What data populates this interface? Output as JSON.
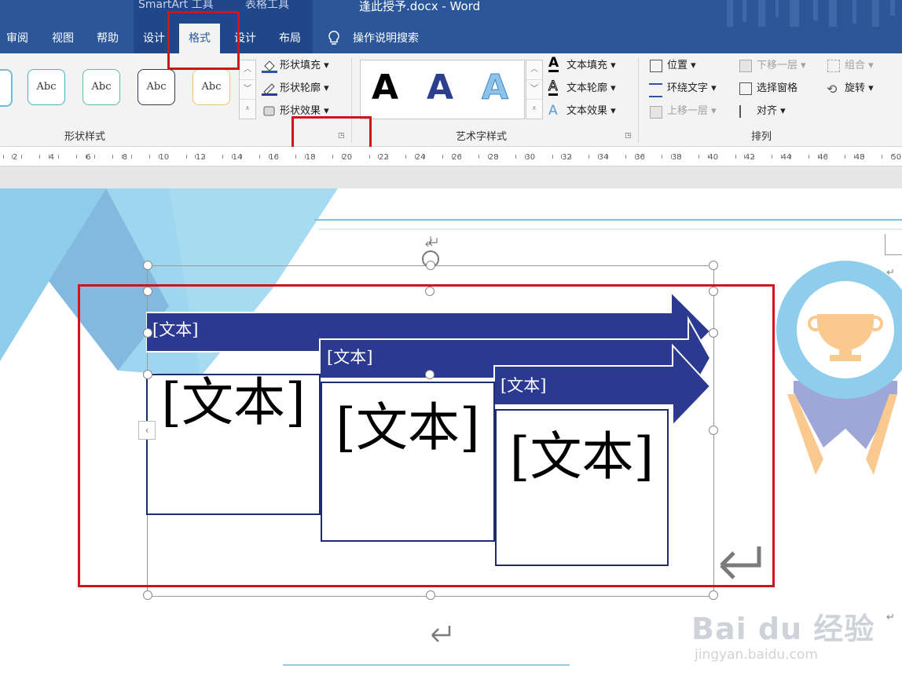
{
  "window": {
    "context_tab_smartart": "SmartArt 工具",
    "context_tab_table": "表格工具",
    "doc_title": "逢此授予.docx  -  Word"
  },
  "tabs": [
    "审阅",
    "视图",
    "帮助",
    "设计",
    "格式",
    "设计",
    "布局"
  ],
  "active_tab": "格式",
  "tell_me": "操作说明搜索",
  "ribbon": {
    "shape_styles": {
      "label": "形状样式",
      "abc": [
        "Abc",
        "Abc",
        "Abc",
        "Abc"
      ],
      "fill": "形状填充",
      "outline": "形状轮廓",
      "effects": "形状效果"
    },
    "wordart": {
      "label": "艺术字样式",
      "letters": [
        "A",
        "A",
        "A"
      ],
      "text_fill": "文本填充",
      "text_outline": "文本轮廓",
      "text_effects": "文本效果"
    },
    "arrange": {
      "label": "排列",
      "position": "位置",
      "wrap": "环绕文字",
      "bring_forward": "上移一层",
      "send_backward": "下移一层",
      "selection_pane": "选择窗格",
      "align": "对齐",
      "group": "组合",
      "rotate": "旋转"
    }
  },
  "ruler": {
    "ticks": [
      "2",
      "4",
      "6",
      "8",
      "10",
      "12",
      "14",
      "16",
      "18",
      "20",
      "22",
      "24",
      "26",
      "28",
      "30",
      "32",
      "34",
      "36",
      "38",
      "40",
      "42",
      "44",
      "46",
      "48",
      "50"
    ]
  },
  "smartart": {
    "banners": [
      "[文本]",
      "[文本]",
      "[文本]"
    ],
    "boxes": [
      "[文本]",
      "[文本]",
      "[文本]"
    ]
  },
  "watermark": {
    "brand": "Bai du 经验",
    "url": "jingyan.baidu.com"
  },
  "colors": {
    "ribbon_blue": "#2b579a",
    "smartart_navy": "#2b3990",
    "highlight_red": "#d0141c",
    "badge_blue": "#8fcdec",
    "trophy_gold": "#f9c98f"
  }
}
